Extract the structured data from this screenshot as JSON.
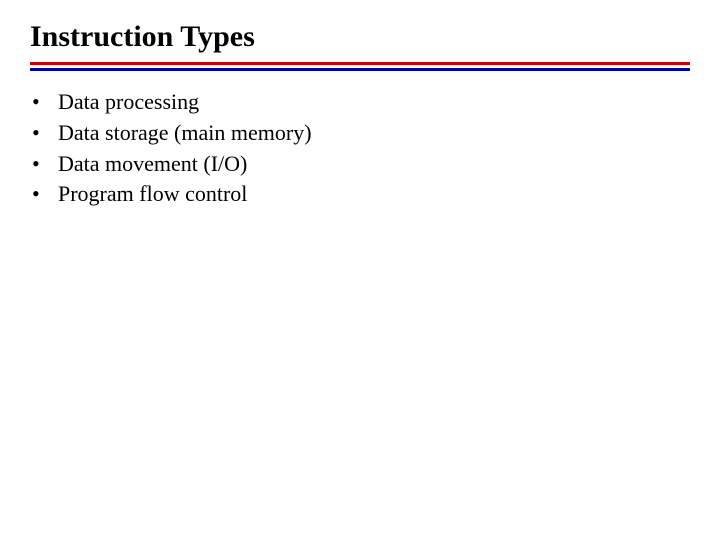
{
  "title": "Instruction Types",
  "bullets": [
    {
      "text": "Data processing"
    },
    {
      "text": "Data storage (main memory)"
    },
    {
      "text": "Data movement (I/O)"
    },
    {
      "text": "Program flow control"
    }
  ]
}
